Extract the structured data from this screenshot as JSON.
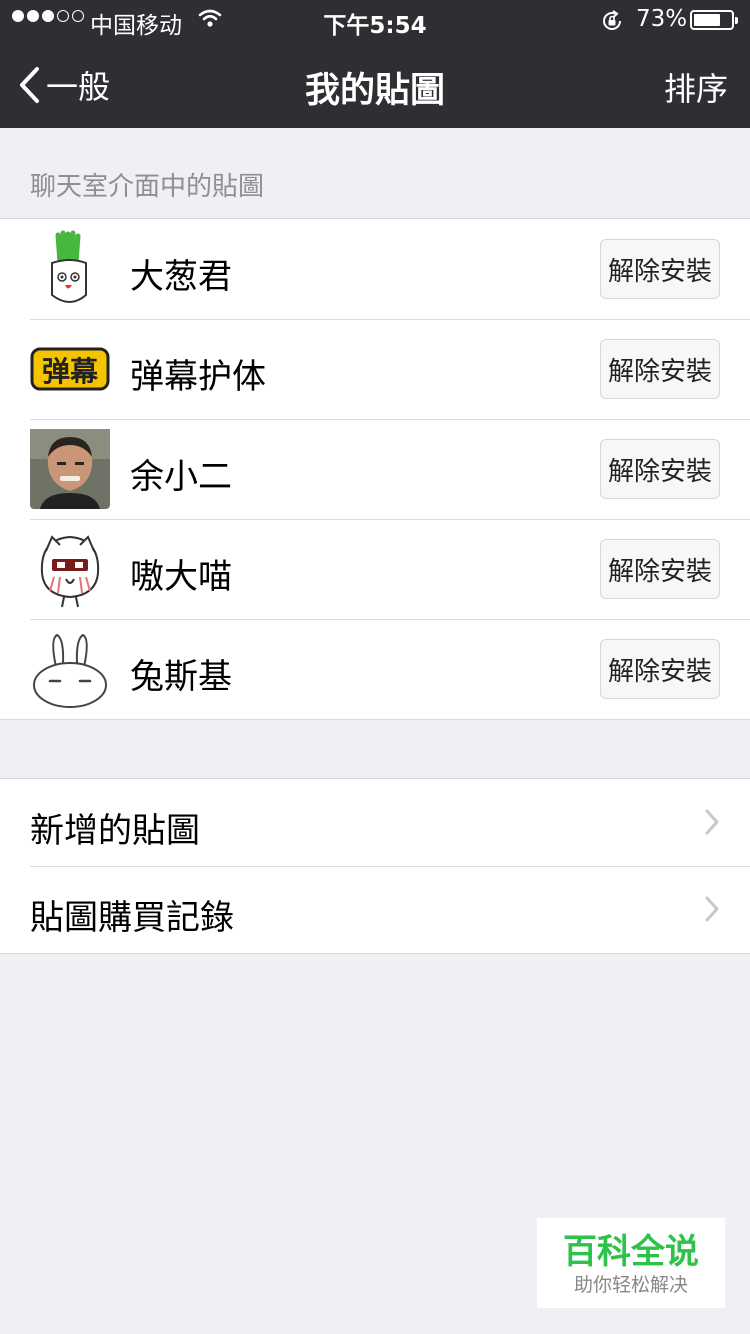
{
  "status_bar": {
    "carrier": "中国移动",
    "time": "下午5:54",
    "battery": "73%",
    "battery_level": 0.73,
    "signal_bars": 3,
    "signal_total": 5
  },
  "nav": {
    "back_label": "一般",
    "title": "我的貼圖",
    "right_label": "排序"
  },
  "section_header": "聊天室介面中的貼圖",
  "stickers": [
    {
      "name": "大葱君",
      "icon": "green-onion-sticker-icon",
      "action": "解除安裝"
    },
    {
      "name": "弹幕护体",
      "icon": "danmu-sticker-icon",
      "action": "解除安裝",
      "badge_text": "弹幕"
    },
    {
      "name": "余小二",
      "icon": "man-face-sticker-icon",
      "action": "解除安裝"
    },
    {
      "name": "嗷大喵",
      "icon": "cat-sticker-icon",
      "action": "解除安裝"
    },
    {
      "name": "兔斯基",
      "icon": "rabbit-sticker-icon",
      "action": "解除安裝"
    }
  ],
  "links": [
    {
      "label": "新增的貼圖"
    },
    {
      "label": "貼圖購買記錄"
    }
  ],
  "watermark": {
    "title": "百科全说",
    "subtitle": "助你轻松解决"
  },
  "colors": {
    "nav_background": "#2e2e33",
    "page_background": "#efeff4",
    "watermark_green": "#2ec24a"
  }
}
